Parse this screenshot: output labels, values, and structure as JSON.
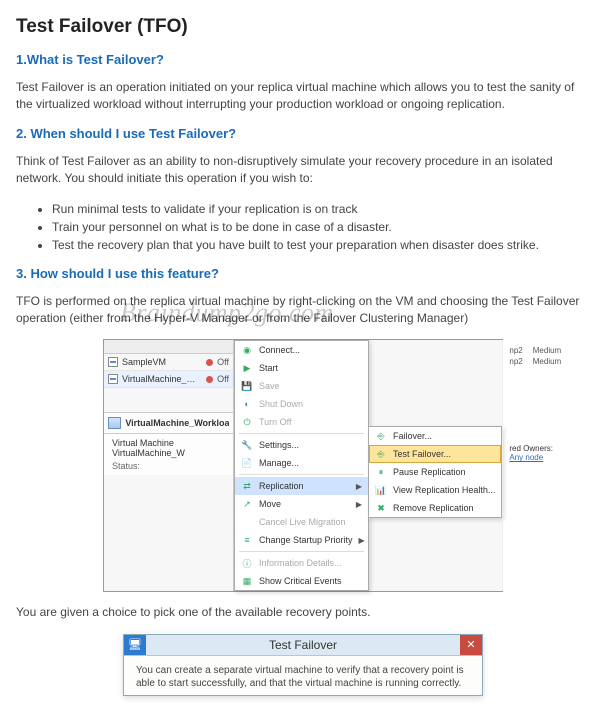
{
  "doc": {
    "page_title": "Test Failover (TFO)",
    "q1_heading": "1.What is Test Failover?",
    "q1_body": "Test Failover is an operation initiated on your replica virtual machine which allows you to test the sanity of the virtualized workload without interrupting your production workload or ongoing replication.",
    "q2_heading": "2. When should I use Test Failover?",
    "q2_body": "Think of Test Failover as an ability to non-disruptively simulate your recovery procedure in an isolated network. You should initiate this operation if you wish to:",
    "q2_bullets": [
      "Run minimal tests to validate if your replication is on track",
      "Train your personnel on what is to be done in case of a disaster.",
      "Test the recovery plan that you have built to test your preparation when disaster does strike."
    ],
    "q3_heading": "3. How should I use this feature?",
    "q3_body": "TFO is performed on the replica virtual machine by right-clicking on the VM and choosing the Test Failover operation (either from the Hyper-V Manager or from the Failover Clustering Manager)",
    "post_shot": "You are given a choice to pick one of the available recovery points."
  },
  "watermark": "Braindump2go.com",
  "shot": {
    "vms": [
      {
        "name": "SampleVM",
        "state": "Off"
      },
      {
        "name": "VirtualMachine_Workload",
        "state": "Off"
      }
    ],
    "role_panel": "VirtualMachine_Workload",
    "role_panel2_prefix": "Virtual Machine",
    "role_panel2_name": "VirtualMachine_W",
    "status_label": "Status:",
    "right_hdr1": "np2",
    "right_hdr1b": "Medium",
    "right_hdr2": "np2",
    "right_hdr2b": "Medium",
    "owners_label": "red Owners:",
    "owners_link": "Any node",
    "menu": {
      "connect": "Connect...",
      "start": "Start",
      "save": "Save",
      "shutdown": "Shut Down",
      "turnoff": "Turn Off",
      "settings": "Settings...",
      "manage": "Manage...",
      "replication": "Replication",
      "move": "Move",
      "cancel_lm": "Cancel Live Migration",
      "change_prio": "Change Startup Priority",
      "info": "Information Details...",
      "crit_events": "Show Critical Events"
    },
    "submenu": {
      "failover": "Failover...",
      "test_failover": "Test Failover...",
      "pause": "Pause Replication",
      "health": "View Replication Health...",
      "remove": "Remove Replication"
    },
    "icons": {
      "connect": "◉",
      "start": "▶",
      "save": "💾",
      "shutdown": "◐",
      "turnoff": "⏻",
      "settings": "🔧",
      "manage": "📄",
      "replication": "⇄",
      "move": "↗",
      "change_prio": "≡",
      "info": "ⓘ",
      "crit_events": "▦"
    }
  },
  "dialog": {
    "title": "Test Failover",
    "icon": "🖥",
    "close": "✕",
    "body": "You can create a separate virtual machine to verify that a recovery point is able to start successfully, and that the virtual machine is running correctly."
  }
}
